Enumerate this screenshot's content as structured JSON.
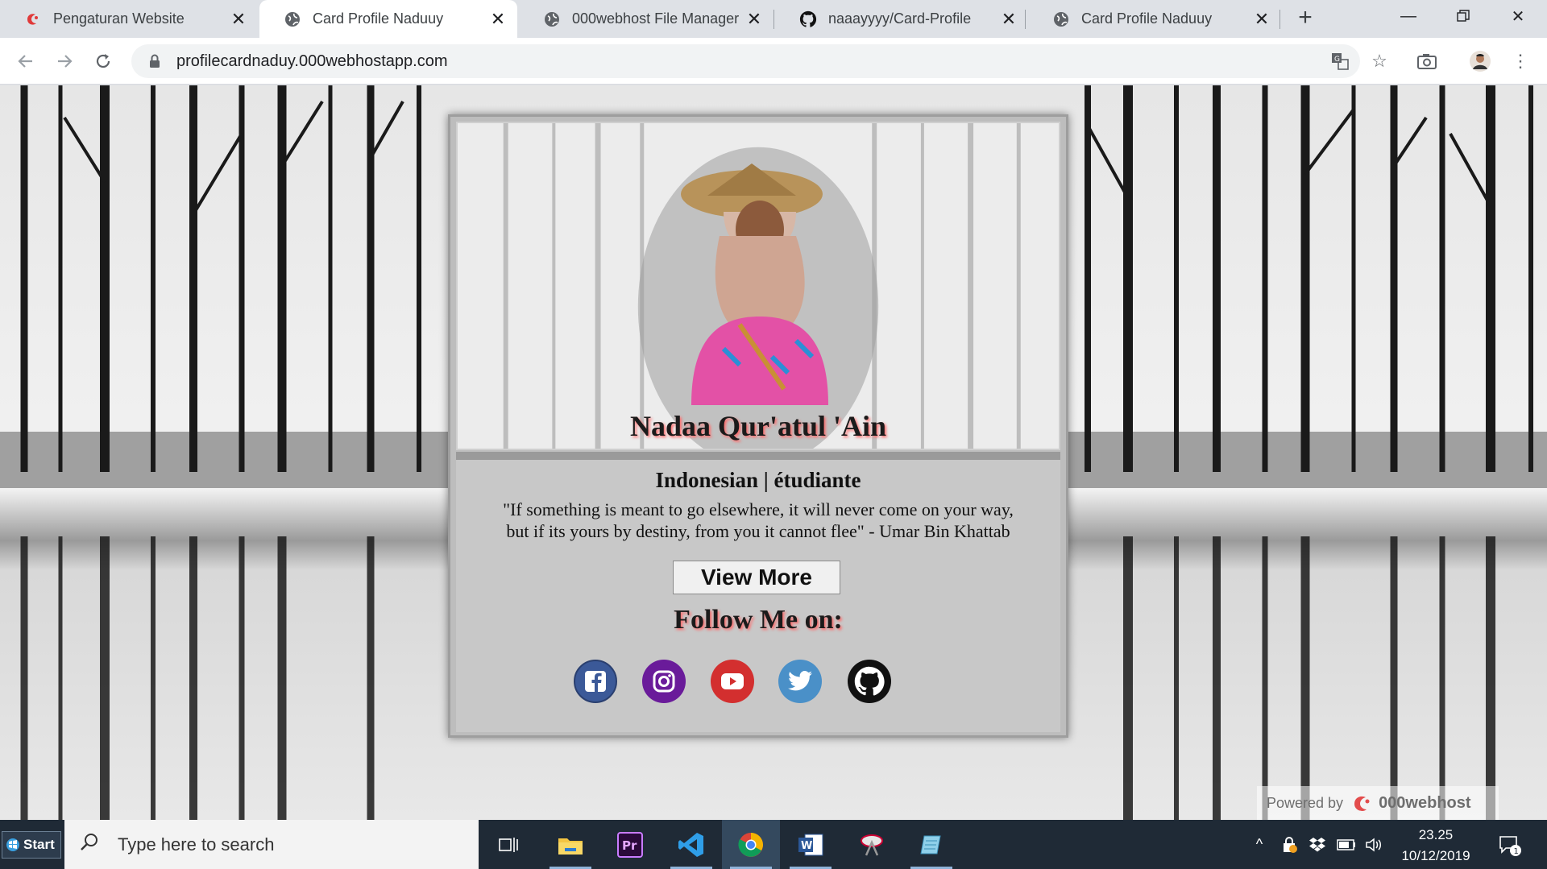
{
  "browser": {
    "tabs": [
      {
        "title": "Pengaturan Website",
        "icon": "000webhost-icon",
        "active": false
      },
      {
        "title": "Card Profile Naduuy",
        "icon": "globe-icon",
        "active": true
      },
      {
        "title": "000webhost File Manager",
        "icon": "globe-icon",
        "active": false
      },
      {
        "title": "naaayyyy/Card-Profile",
        "icon": "github-icon",
        "active": false
      },
      {
        "title": "Card Profile Naduuy",
        "icon": "globe-icon",
        "active": false
      }
    ],
    "url": "profilecardnaduy.000webhostapp.com"
  },
  "card": {
    "name": "Nadaa Qur'atul 'Ain",
    "subtitle": "Indonesian | étudiante",
    "quote_line1": "\"If something is meant to go elsewhere, it will never come on your way,",
    "quote_line2": "but if its yours by destiny, from you it cannot flee\" - Umar Bin Khattab",
    "view_more": "View More",
    "follow_title": "Follow Me on:",
    "socials": [
      {
        "name": "facebook",
        "color": "#3b5998"
      },
      {
        "name": "instagram",
        "color": "#6a1b9a"
      },
      {
        "name": "youtube",
        "color": "#d32f2f"
      },
      {
        "name": "twitter",
        "color": "#1da1f2"
      },
      {
        "name": "github",
        "color": "#111111"
      }
    ]
  },
  "powered": {
    "label": "Powered by",
    "brand": "000webhost"
  },
  "taskbar": {
    "start": "Start",
    "search_placeholder": "Type here to search",
    "time": "23.25",
    "date": "10/12/2019",
    "notifications": "1"
  }
}
